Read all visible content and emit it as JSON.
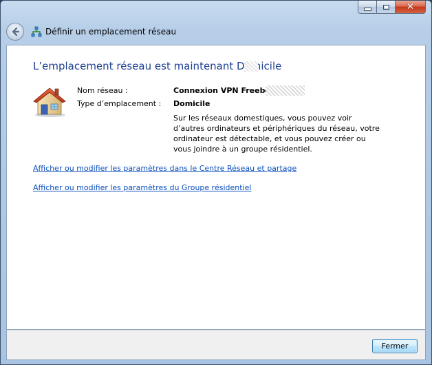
{
  "window": {
    "title": "Définir un emplacement réseau"
  },
  "content": {
    "heading": "L’emplacement réseau est maintenant Domicile",
    "network_name_label": "Nom réseau :",
    "network_name_value": "Connexion VPN Freebox",
    "location_type_label": "Type d’emplacement :",
    "location_type_value": "Domicile",
    "description": "Sur les réseaux domestiques, vous pouvez voir d’autres ordinateurs et périphériques du réseau, votre ordinateur est détectable, et vous pouvez créer ou vous joindre à un groupe résidentiel.",
    "links": [
      {
        "label": "Afficher ou modifier les paramètres dans le Centre Réseau et partage"
      },
      {
        "label": "Afficher ou modifier les paramètres du Groupe résidentiel"
      }
    ]
  },
  "footer": {
    "close_label": "Fermer"
  },
  "icons": {
    "back": "back-arrow-icon",
    "network": "network-icon",
    "home": "house-icon"
  },
  "colors": {
    "heading": "#1e3f92",
    "link": "#0b4fbd",
    "close_button": "#c3371b"
  }
}
